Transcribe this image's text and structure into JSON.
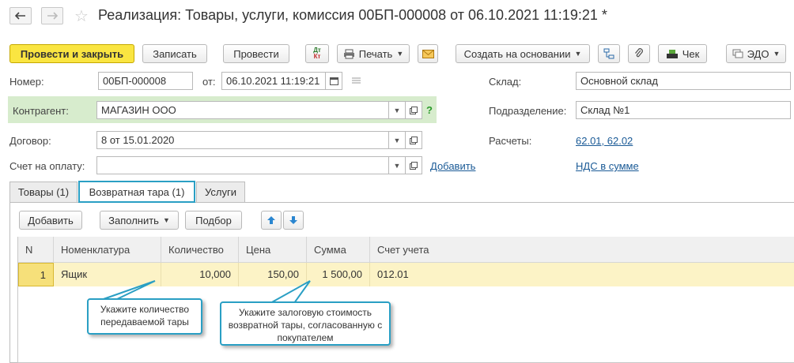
{
  "window": {
    "title": "Реализация: Товары, услуги, комиссия 00БП-000008 от 06.10.2021 11:19:21 *"
  },
  "toolbar": {
    "post_and_close": "Провести и закрыть",
    "save": "Записать",
    "post": "Провести",
    "dtkt_top": "Дт",
    "dtkt_bottom": "Кт",
    "print": "Печать",
    "create_based_on": "Создать на основании",
    "check": "Чек",
    "edo": "ЭДО"
  },
  "form": {
    "number_label": "Номер:",
    "number_value": "00БП-000008",
    "date_label": "от:",
    "date_value": "06.10.2021 11:19:21",
    "warehouse_label": "Склад:",
    "warehouse_value": "Основной склад",
    "counterparty_label": "Контрагент:",
    "counterparty_value": "МАГАЗИН ООО",
    "help": "?",
    "division_label": "Подразделение:",
    "division_value": "Склад №1",
    "contract_label": "Договор:",
    "contract_value": "8 от 15.01.2020",
    "settlements_label": "Расчеты:",
    "settlements_link": "62.01, 62.02",
    "invoice_label": "Счет на оплату:",
    "invoice_value": "",
    "add_link": "Добавить",
    "vat_link": "НДС в сумме"
  },
  "tabs": [
    {
      "label": "Товары (1)"
    },
    {
      "label": "Возвратная тара (1)"
    },
    {
      "label": "Услуги"
    }
  ],
  "table_toolbar": {
    "add": "Добавить",
    "fill": "Заполнить",
    "select": "Подбор"
  },
  "table": {
    "columns": [
      "N",
      "Номенклатура",
      "Количество",
      "Цена",
      "Сумма",
      "Счет учета"
    ],
    "rows": [
      {
        "n": "1",
        "item": "Ящик",
        "qty": "10,000",
        "price": "150,00",
        "sum": "1 500,00",
        "account": "012.01"
      }
    ]
  },
  "callouts": {
    "qty": "Укажите количество передаваемой тары",
    "price": "Укажите залоговую стоимость возвратной тары, согласованную с покупателем"
  }
}
